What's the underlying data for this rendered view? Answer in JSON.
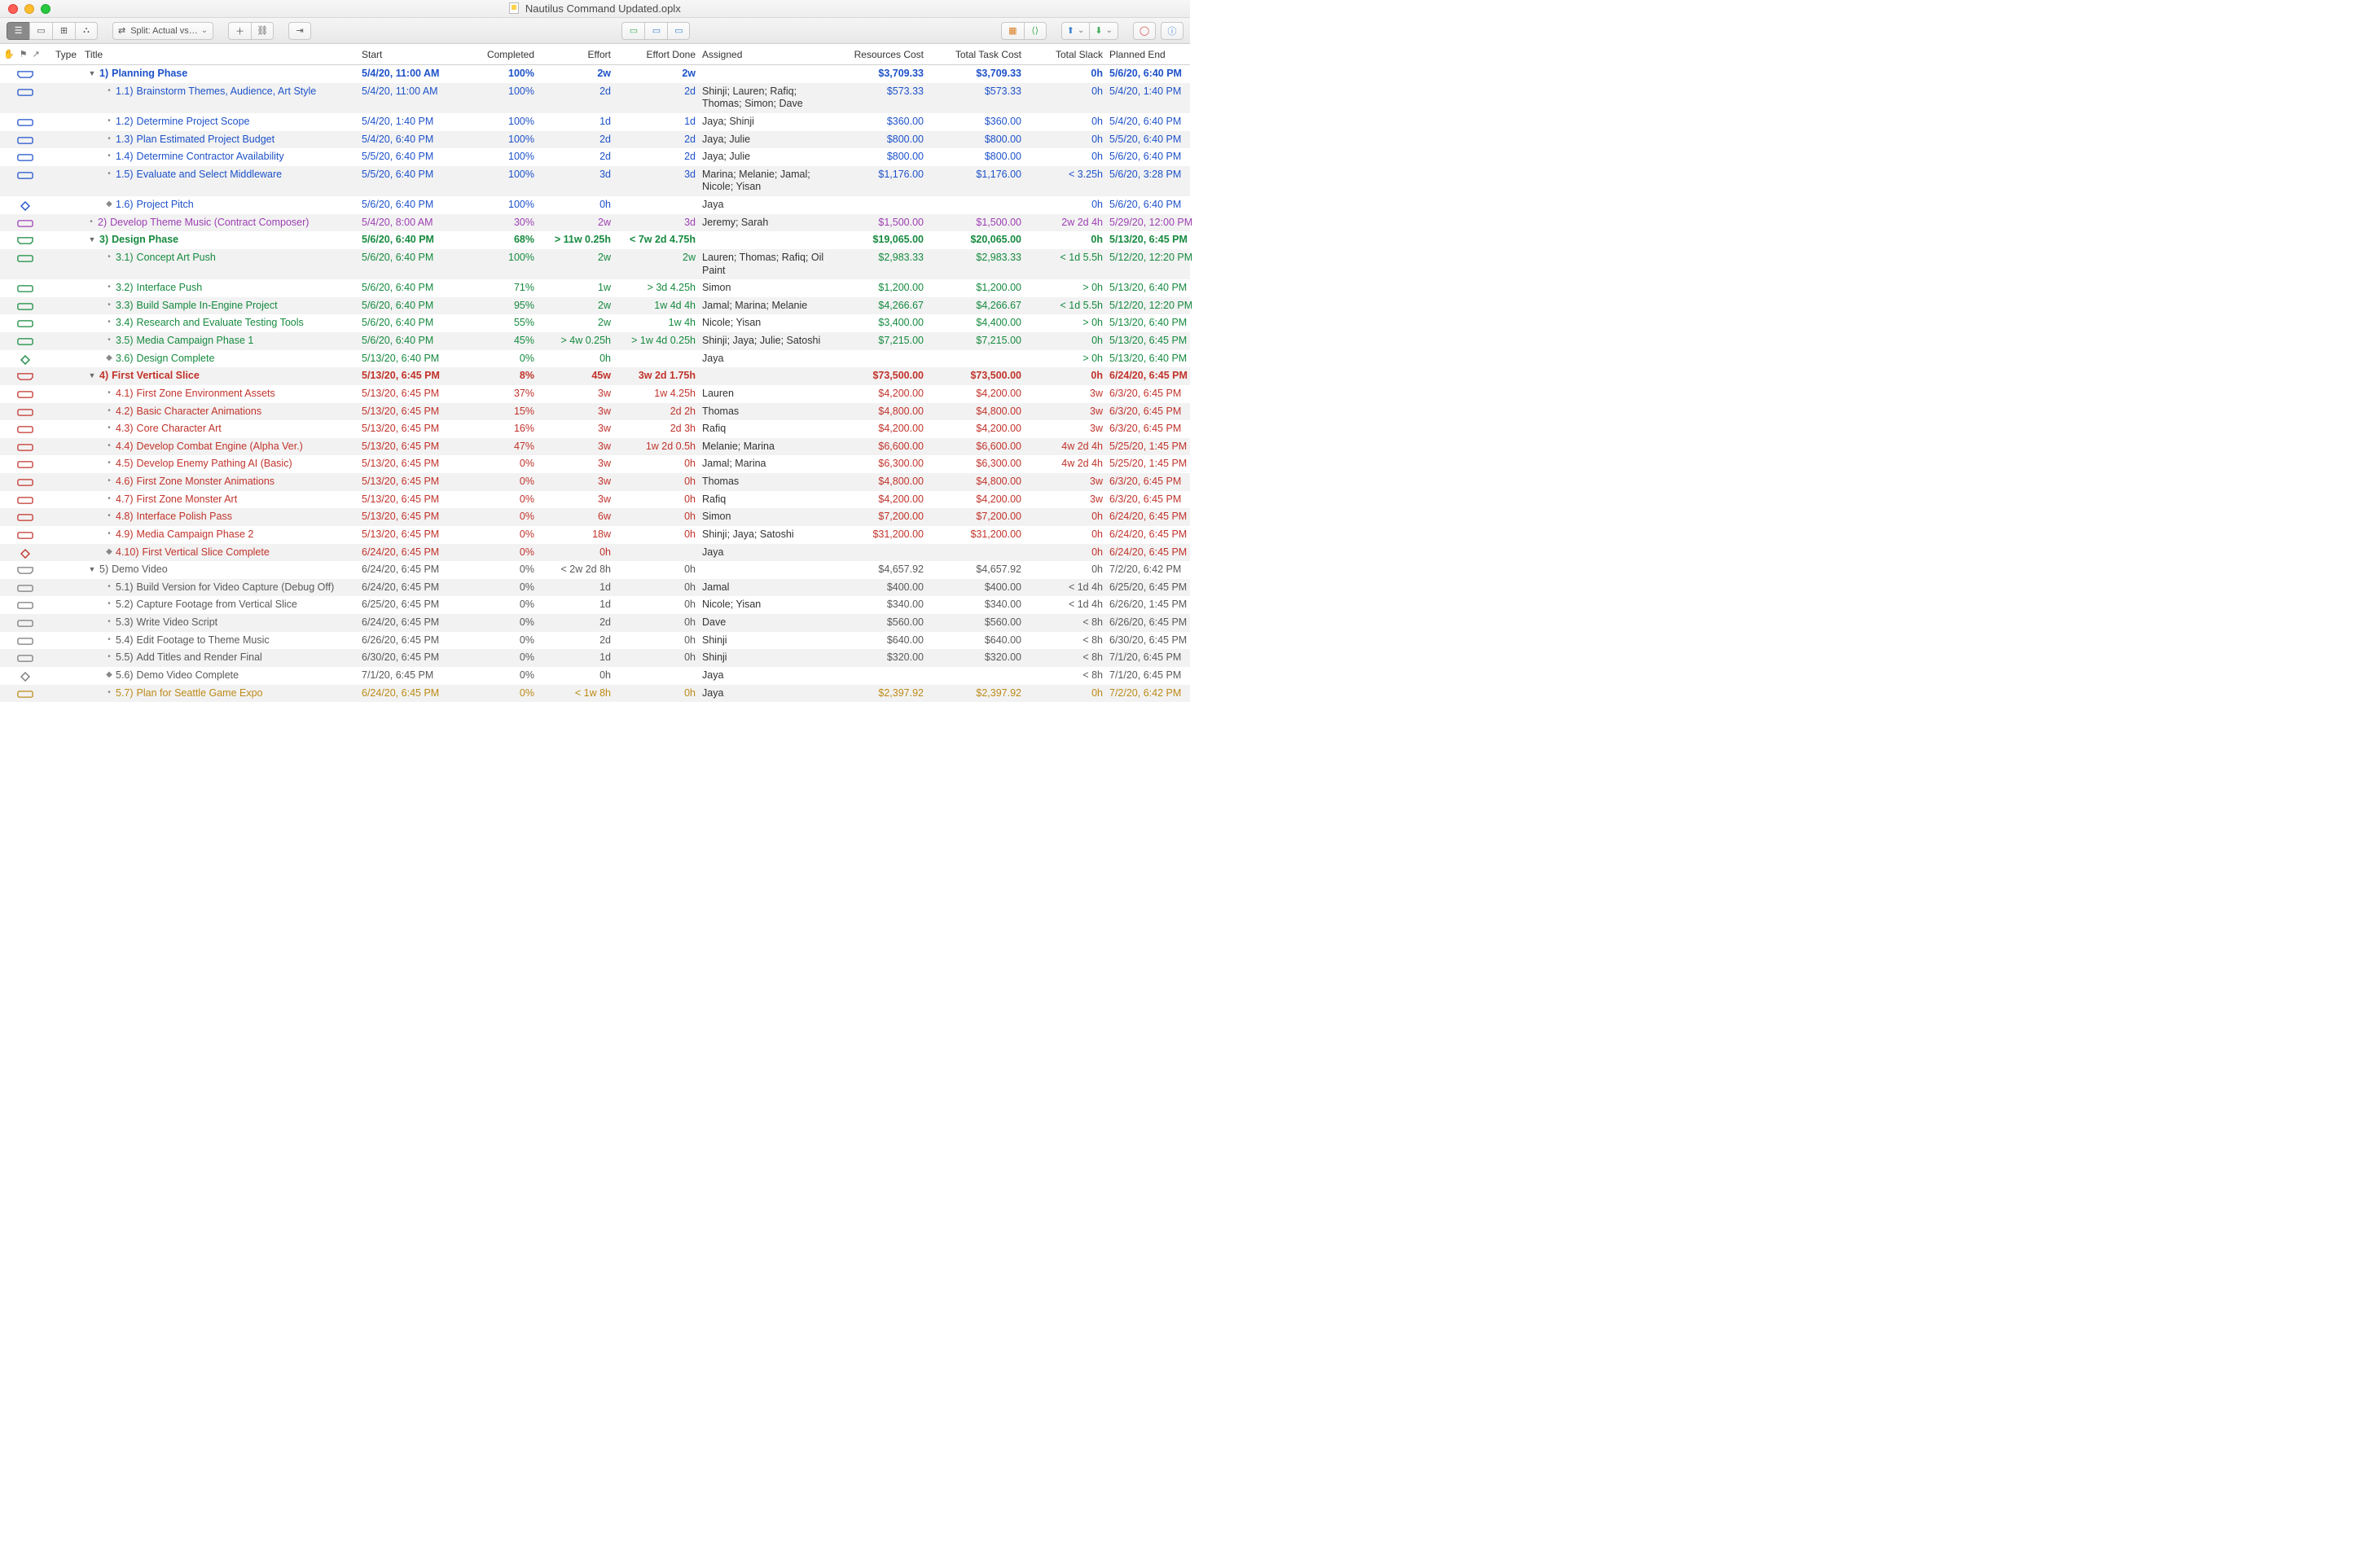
{
  "window_title": "Nautilus Command Updated.oplx",
  "toolbar": {
    "split_label": "Split: Actual vs…"
  },
  "columns": {
    "type": "Type",
    "title": "Title",
    "start": "Start",
    "completed": "Completed",
    "effort": "Effort",
    "effort_done": "Effort Done",
    "assigned": "Assigned",
    "resources_cost": "Resources Cost",
    "total_task_cost": "Total Task Cost",
    "total_slack": "Total Slack",
    "planned_end": "Planned End"
  },
  "rows": [
    {
      "stripe": 0,
      "color": "blue",
      "bold": 1,
      "group": 1,
      "depth": 0,
      "kind": "group",
      "num": "1)",
      "title": "Planning Phase",
      "start": "5/4/20, 11:00 AM",
      "completed": "100%",
      "effort": "2w",
      "effort_done": "2w",
      "assigned": "",
      "res": "$3,709.33",
      "tot": "$3,709.33",
      "slack": "0h",
      "end": "5/6/20, 6:40 PM"
    },
    {
      "stripe": 1,
      "color": "blue",
      "depth": 1,
      "kind": "task",
      "num": "1.1)",
      "title": "Brainstorm Themes, Audience, Art Style",
      "start": "5/4/20, 11:00 AM",
      "completed": "100%",
      "effort": "2d",
      "effort_done": "2d",
      "assigned": "Shinji; Lauren; Rafiq; Thomas; Simon; Dave",
      "res": "$573.33",
      "tot": "$573.33",
      "slack": "0h",
      "end": "5/4/20, 1:40 PM"
    },
    {
      "stripe": 0,
      "color": "blue",
      "depth": 1,
      "kind": "task",
      "num": "1.2)",
      "title": "Determine Project Scope",
      "start": "5/4/20, 1:40 PM",
      "completed": "100%",
      "effort": "1d",
      "effort_done": "1d",
      "assigned": "Jaya; Shinji",
      "res": "$360.00",
      "tot": "$360.00",
      "slack": "0h",
      "end": "5/4/20, 6:40 PM"
    },
    {
      "stripe": 1,
      "color": "blue",
      "depth": 1,
      "kind": "task",
      "num": "1.3)",
      "title": "Plan Estimated Project Budget",
      "start": "5/4/20, 6:40 PM",
      "completed": "100%",
      "effort": "2d",
      "effort_done": "2d",
      "assigned": "Jaya; Julie",
      "res": "$800.00",
      "tot": "$800.00",
      "slack": "0h",
      "end": "5/5/20, 6:40 PM"
    },
    {
      "stripe": 0,
      "color": "blue",
      "depth": 1,
      "kind": "task",
      "num": "1.4)",
      "title": "Determine Contractor Availability",
      "start": "5/5/20, 6:40 PM",
      "completed": "100%",
      "effort": "2d",
      "effort_done": "2d",
      "assigned": "Jaya; Julie",
      "res": "$800.00",
      "tot": "$800.00",
      "slack": "0h",
      "end": "5/6/20, 6:40 PM"
    },
    {
      "stripe": 1,
      "color": "blue",
      "depth": 1,
      "kind": "task",
      "num": "1.5)",
      "title": "Evaluate and Select Middleware",
      "start": "5/5/20, 6:40 PM",
      "completed": "100%",
      "effort": "3d",
      "effort_done": "3d",
      "assigned": "Marina; Melanie; Jamal; Nicole; Yisan",
      "res": "$1,176.00",
      "tot": "$1,176.00",
      "slack": "< 3.25h",
      "end": "5/6/20, 3:28 PM"
    },
    {
      "stripe": 0,
      "color": "blue",
      "depth": 1,
      "kind": "milestone",
      "num": "1.6)",
      "title": "Project Pitch",
      "start": "5/6/20, 6:40 PM",
      "completed": "100%",
      "effort": "0h",
      "effort_done": "",
      "assigned": "Jaya",
      "res": "",
      "tot": "",
      "slack": "0h",
      "end": "5/6/20, 6:40 PM"
    },
    {
      "stripe": 1,
      "color": "purple",
      "depth": 0,
      "kind": "task",
      "num": "2)",
      "title": "Develop Theme Music (Contract Composer)",
      "start": "5/4/20, 8:00 AM",
      "completed": "30%",
      "effort": "2w",
      "effort_done": "3d",
      "assigned": "Jeremy; Sarah",
      "res": "$1,500.00",
      "tot": "$1,500.00",
      "slack": "2w 2d 4h",
      "end": "5/29/20, 12:00 PM"
    },
    {
      "stripe": 0,
      "color": "green",
      "bold": 1,
      "group": 1,
      "depth": 0,
      "kind": "group",
      "num": "3)",
      "title": "Design Phase",
      "start": "5/6/20, 6:40 PM",
      "completed": "68%",
      "effort": "> 11w 0.25h",
      "effort_done": "< 7w 2d 4.75h",
      "assigned": "",
      "res": "$19,065.00",
      "tot": "$20,065.00",
      "slack": "0h",
      "end": "5/13/20, 6:45 PM"
    },
    {
      "stripe": 1,
      "color": "green",
      "depth": 1,
      "kind": "task",
      "num": "3.1)",
      "title": "Concept Art Push",
      "start": "5/6/20, 6:40 PM",
      "completed": "100%",
      "effort": "2w",
      "effort_done": "2w",
      "assigned": "Lauren; Thomas; Rafiq; Oil Paint",
      "res": "$2,983.33",
      "tot": "$2,983.33",
      "slack": "< 1d 5.5h",
      "end": "5/12/20, 12:20 PM"
    },
    {
      "stripe": 0,
      "color": "green",
      "depth": 1,
      "kind": "task",
      "num": "3.2)",
      "title": "Interface Push",
      "start": "5/6/20, 6:40 PM",
      "completed": "71%",
      "effort": "1w",
      "effort_done": "> 3d 4.25h",
      "assigned": "Simon",
      "res": "$1,200.00",
      "tot": "$1,200.00",
      "slack": "> 0h",
      "end": "5/13/20, 6:40 PM"
    },
    {
      "stripe": 1,
      "color": "green",
      "depth": 1,
      "kind": "task",
      "num": "3.3)",
      "title": "Build Sample In-Engine Project",
      "start": "5/6/20, 6:40 PM",
      "completed": "95%",
      "effort": "2w",
      "effort_done": "1w 4d 4h",
      "assigned": "Jamal; Marina; Melanie",
      "res": "$4,266.67",
      "tot": "$4,266.67",
      "slack": "< 1d 5.5h",
      "end": "5/12/20, 12:20 PM"
    },
    {
      "stripe": 0,
      "color": "green",
      "depth": 1,
      "kind": "task",
      "num": "3.4)",
      "title": "Research and Evaluate Testing Tools",
      "start": "5/6/20, 6:40 PM",
      "completed": "55%",
      "effort": "2w",
      "effort_done": "1w 4h",
      "assigned": "Nicole; Yisan",
      "res": "$3,400.00",
      "tot": "$4,400.00",
      "slack": "> 0h",
      "end": "5/13/20, 6:40 PM"
    },
    {
      "stripe": 1,
      "color": "green",
      "depth": 1,
      "kind": "task",
      "num": "3.5)",
      "title": "Media Campaign Phase 1",
      "start": "5/6/20, 6:40 PM",
      "completed": "45%",
      "effort": "> 4w 0.25h",
      "effort_done": "> 1w 4d 0.25h",
      "assigned": "Shinji; Jaya; Julie; Satoshi",
      "res": "$7,215.00",
      "tot": "$7,215.00",
      "slack": "0h",
      "end": "5/13/20, 6:45 PM"
    },
    {
      "stripe": 0,
      "color": "green",
      "depth": 1,
      "kind": "milestone",
      "num": "3.6)",
      "title": "Design Complete",
      "start": "5/13/20, 6:40 PM",
      "completed": "0%",
      "effort": "0h",
      "effort_done": "",
      "assigned": "Jaya",
      "res": "",
      "tot": "",
      "slack": "> 0h",
      "end": "5/13/20, 6:40 PM"
    },
    {
      "stripe": 1,
      "color": "red",
      "bold": 1,
      "group": 1,
      "depth": 0,
      "kind": "group",
      "num": "4)",
      "title": "First Vertical Slice",
      "start": "5/13/20, 6:45 PM",
      "completed": "8%",
      "effort": "45w",
      "effort_done": "3w 2d 1.75h",
      "assigned": "",
      "res": "$73,500.00",
      "tot": "$73,500.00",
      "slack": "0h",
      "end": "6/24/20, 6:45 PM"
    },
    {
      "stripe": 0,
      "color": "red",
      "depth": 1,
      "kind": "task",
      "num": "4.1)",
      "title": "First Zone Environment Assets",
      "start": "5/13/20, 6:45 PM",
      "completed": "37%",
      "effort": "3w",
      "effort_done": "1w 4.25h",
      "assigned": "Lauren",
      "res": "$4,200.00",
      "tot": "$4,200.00",
      "slack": "3w",
      "end": "6/3/20, 6:45 PM"
    },
    {
      "stripe": 1,
      "color": "red",
      "depth": 1,
      "kind": "task",
      "num": "4.2)",
      "title": "Basic Character Animations",
      "start": "5/13/20, 6:45 PM",
      "completed": "15%",
      "effort": "3w",
      "effort_done": "2d 2h",
      "assigned": "Thomas",
      "res": "$4,800.00",
      "tot": "$4,800.00",
      "slack": "3w",
      "end": "6/3/20, 6:45 PM"
    },
    {
      "stripe": 0,
      "color": "red",
      "depth": 1,
      "kind": "task",
      "num": "4.3)",
      "title": "Core Character Art",
      "start": "5/13/20, 6:45 PM",
      "completed": "16%",
      "effort": "3w",
      "effort_done": "2d 3h",
      "assigned": "Rafiq",
      "res": "$4,200.00",
      "tot": "$4,200.00",
      "slack": "3w",
      "end": "6/3/20, 6:45 PM"
    },
    {
      "stripe": 1,
      "color": "red",
      "depth": 1,
      "kind": "task",
      "num": "4.4)",
      "title": "Develop Combat Engine (Alpha Ver.)",
      "start": "5/13/20, 6:45 PM",
      "completed": "47%",
      "effort": "3w",
      "effort_done": "1w 2d 0.5h",
      "assigned": "Melanie; Marina",
      "res": "$6,600.00",
      "tot": "$6,600.00",
      "slack": "4w 2d 4h",
      "end": "5/25/20, 1:45 PM"
    },
    {
      "stripe": 0,
      "color": "red",
      "depth": 1,
      "kind": "task",
      "num": "4.5)",
      "title": "Develop Enemy Pathing AI (Basic)",
      "start": "5/13/20, 6:45 PM",
      "completed": "0%",
      "effort": "3w",
      "effort_done": "0h",
      "assigned": "Jamal; Marina",
      "res": "$6,300.00",
      "tot": "$6,300.00",
      "slack": "4w 2d 4h",
      "end": "5/25/20, 1:45 PM"
    },
    {
      "stripe": 1,
      "color": "red",
      "depth": 1,
      "kind": "task",
      "num": "4.6)",
      "title": "First Zone Monster Animations",
      "start": "5/13/20, 6:45 PM",
      "completed": "0%",
      "effort": "3w",
      "effort_done": "0h",
      "assigned": "Thomas",
      "res": "$4,800.00",
      "tot": "$4,800.00",
      "slack": "3w",
      "end": "6/3/20, 6:45 PM"
    },
    {
      "stripe": 0,
      "color": "red",
      "depth": 1,
      "kind": "task",
      "num": "4.7)",
      "title": "First Zone Monster Art",
      "start": "5/13/20, 6:45 PM",
      "completed": "0%",
      "effort": "3w",
      "effort_done": "0h",
      "assigned": "Rafiq",
      "res": "$4,200.00",
      "tot": "$4,200.00",
      "slack": "3w",
      "end": "6/3/20, 6:45 PM"
    },
    {
      "stripe": 1,
      "color": "red",
      "depth": 1,
      "kind": "task",
      "num": "4.8)",
      "title": "Interface Polish Pass",
      "start": "5/13/20, 6:45 PM",
      "completed": "0%",
      "effort": "6w",
      "effort_done": "0h",
      "assigned": "Simon",
      "res": "$7,200.00",
      "tot": "$7,200.00",
      "slack": "0h",
      "end": "6/24/20, 6:45 PM"
    },
    {
      "stripe": 0,
      "color": "red",
      "depth": 1,
      "kind": "task",
      "num": "4.9)",
      "title": "Media Campaign Phase 2",
      "start": "5/13/20, 6:45 PM",
      "completed": "0%",
      "effort": "18w",
      "effort_done": "0h",
      "assigned": "Shinji; Jaya; Satoshi",
      "res": "$31,200.00",
      "tot": "$31,200.00",
      "slack": "0h",
      "end": "6/24/20, 6:45 PM"
    },
    {
      "stripe": 1,
      "color": "red",
      "depth": 1,
      "kind": "milestone",
      "num": "4.10)",
      "title": "First Vertical Slice Complete",
      "start": "6/24/20, 6:45 PM",
      "completed": "0%",
      "effort": "0h",
      "effort_done": "",
      "assigned": "Jaya",
      "res": "",
      "tot": "",
      "slack": "0h",
      "end": "6/24/20, 6:45 PM"
    },
    {
      "stripe": 0,
      "color": "gray",
      "bold": 0,
      "group": 1,
      "depth": 0,
      "kind": "group",
      "num": "5)",
      "title": "Demo Video",
      "start": "6/24/20, 6:45 PM",
      "completed": "0%",
      "effort": "< 2w 2d 8h",
      "effort_done": "0h",
      "assigned": "",
      "res": "$4,657.92",
      "tot": "$4,657.92",
      "slack": "0h",
      "end": "7/2/20, 6:42 PM"
    },
    {
      "stripe": 1,
      "color": "gray",
      "depth": 1,
      "kind": "task",
      "num": "5.1)",
      "title": "Build Version for Video Capture (Debug Off)",
      "start": "6/24/20, 6:45 PM",
      "completed": "0%",
      "effort": "1d",
      "effort_done": "0h",
      "assigned": "Jamal",
      "res": "$400.00",
      "tot": "$400.00",
      "slack": "< 1d 4h",
      "end": "6/25/20, 6:45 PM"
    },
    {
      "stripe": 0,
      "color": "gray",
      "depth": 1,
      "kind": "task",
      "num": "5.2)",
      "title": "Capture Footage from Vertical Slice",
      "start": "6/25/20, 6:45 PM",
      "completed": "0%",
      "effort": "1d",
      "effort_done": "0h",
      "assigned": "Nicole; Yisan",
      "res": "$340.00",
      "tot": "$340.00",
      "slack": "< 1d 4h",
      "end": "6/26/20, 1:45 PM"
    },
    {
      "stripe": 1,
      "color": "gray",
      "depth": 1,
      "kind": "task",
      "num": "5.3)",
      "title": "Write Video Script",
      "start": "6/24/20, 6:45 PM",
      "completed": "0%",
      "effort": "2d",
      "effort_done": "0h",
      "assigned": "Dave",
      "res": "$560.00",
      "tot": "$560.00",
      "slack": "< 8h",
      "end": "6/26/20, 6:45 PM"
    },
    {
      "stripe": 0,
      "color": "gray",
      "depth": 1,
      "kind": "task",
      "num": "5.4)",
      "title": "Edit Footage to Theme Music",
      "start": "6/26/20, 6:45 PM",
      "completed": "0%",
      "effort": "2d",
      "effort_done": "0h",
      "assigned": "Shinji",
      "res": "$640.00",
      "tot": "$640.00",
      "slack": "< 8h",
      "end": "6/30/20, 6:45 PM"
    },
    {
      "stripe": 1,
      "color": "gray",
      "depth": 1,
      "kind": "task",
      "num": "5.5)",
      "title": "Add Titles and Render Final",
      "start": "6/30/20, 6:45 PM",
      "completed": "0%",
      "effort": "1d",
      "effort_done": "0h",
      "assigned": "Shinji",
      "res": "$320.00",
      "tot": "$320.00",
      "slack": "< 8h",
      "end": "7/1/20, 6:45 PM"
    },
    {
      "stripe": 0,
      "color": "gray",
      "depth": 1,
      "kind": "milestone",
      "num": "5.6)",
      "title": "Demo Video Complete",
      "start": "7/1/20, 6:45 PM",
      "completed": "0%",
      "effort": "0h",
      "effort_done": "",
      "assigned": "Jaya",
      "res": "",
      "tot": "",
      "slack": "< 8h",
      "end": "7/1/20, 6:45 PM"
    },
    {
      "stripe": 1,
      "color": "gold",
      "depth": 1,
      "kind": "task",
      "num": "5.7)",
      "title": "Plan for Seattle Game Expo",
      "start": "6/24/20, 6:45 PM",
      "completed": "0%",
      "effort": "< 1w 8h",
      "effort_done": "0h",
      "assigned": "Jaya",
      "res": "$2,397.92",
      "tot": "$2,397.92",
      "slack": "0h",
      "end": "7/2/20, 6:42 PM"
    }
  ]
}
